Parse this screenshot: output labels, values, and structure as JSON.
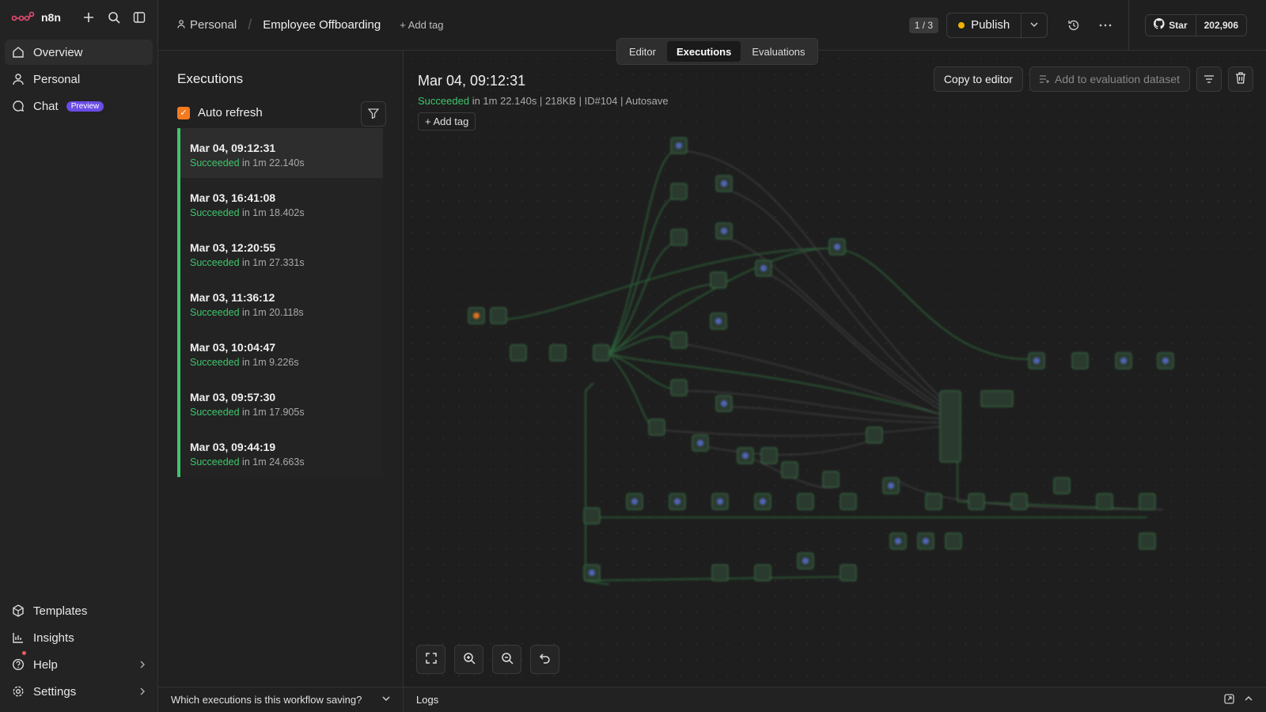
{
  "app": {
    "name": "n8n"
  },
  "sidebar": {
    "items": [
      {
        "label": "Overview",
        "icon": "home-icon"
      },
      {
        "label": "Personal",
        "icon": "user-icon"
      },
      {
        "label": "Chat",
        "icon": "chat-icon",
        "badge": "Preview"
      }
    ],
    "bottom": [
      {
        "label": "Templates",
        "icon": "templates-icon"
      },
      {
        "label": "Insights",
        "icon": "insights-icon"
      },
      {
        "label": "Help",
        "icon": "help-icon"
      },
      {
        "label": "Settings",
        "icon": "gear-icon"
      }
    ]
  },
  "header": {
    "project": "Personal",
    "workflow": "Employee Offboarding",
    "add_tag": "+ Add tag",
    "version": "1 / 3",
    "publish": "Publish",
    "github_star": "Star",
    "github_count": "202,906"
  },
  "tabs": [
    "Editor",
    "Executions",
    "Evaluations"
  ],
  "executions": {
    "title": "Executions",
    "auto_refresh": "Auto refresh",
    "items": [
      {
        "date": "Mar 04, 09:12:31",
        "status": "Succeeded",
        "duration": "in 1m 22.140s"
      },
      {
        "date": "Mar 03, 16:41:08",
        "status": "Succeeded",
        "duration": "in 1m 18.402s"
      },
      {
        "date": "Mar 03, 12:20:55",
        "status": "Succeeded",
        "duration": "in 1m 27.331s"
      },
      {
        "date": "Mar 03, 11:36:12",
        "status": "Succeeded",
        "duration": "in 1m 20.118s"
      },
      {
        "date": "Mar 03, 10:04:47",
        "status": "Succeeded",
        "duration": "in 1m 9.226s"
      },
      {
        "date": "Mar 03, 09:57:30",
        "status": "Succeeded",
        "duration": "in 1m 17.905s"
      },
      {
        "date": "Mar 03, 09:44:19",
        "status": "Succeeded",
        "duration": "in 1m 24.663s"
      }
    ],
    "footer": "Which executions is this workflow saving?"
  },
  "run": {
    "date": "Mar 04, 09:12:31",
    "status": "Succeeded",
    "meta": "in 1m 22.140s | 218KB | ID#104 | Autosave",
    "add_tag": "Add tag",
    "copy_to_editor": "Copy to editor",
    "add_to_dataset": "Add to evaluation dataset"
  },
  "logs": {
    "label": "Logs"
  },
  "colors": {
    "accent": "#f37a1f",
    "success": "#3fc56b",
    "preview": "#6b4ce6",
    "publish_dot": "#f0b400"
  }
}
